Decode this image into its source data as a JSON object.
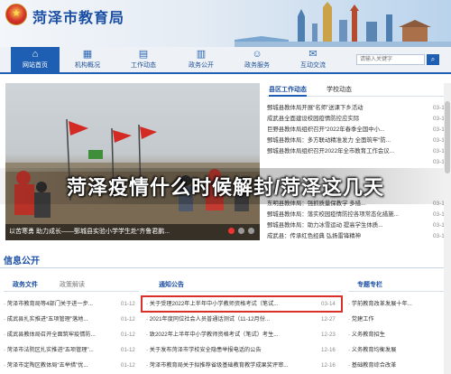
{
  "header": {
    "site_title": "菏泽市教育局",
    "search_placeholder": "请输入关键字"
  },
  "nav": [
    {
      "label": "网站首页",
      "icon": "home-icon",
      "active": true
    },
    {
      "label": "机构概况",
      "icon": "building-icon",
      "active": false
    },
    {
      "label": "工作动态",
      "icon": "document-icon",
      "active": false
    },
    {
      "label": "政务公开",
      "icon": "book-icon",
      "active": false
    },
    {
      "label": "政务服务",
      "icon": "people-icon",
      "active": false
    },
    {
      "label": "互动交流",
      "icon": "chat-icon",
      "active": false
    }
  ],
  "photo": {
    "caption": "以苦寒勇 助力成长——鄄城县实验小学学生赴“齐鲁君鹏..."
  },
  "news_tabs": [
    "县区工作动态",
    "学校动态"
  ],
  "news": [
    {
      "title": "鄄城县教体局开展“名师”送课下乡活动",
      "date": "03-1"
    },
    {
      "title": "成武县全面建设校园疫情防控应实际",
      "date": "03-1"
    },
    {
      "title": "巨野县教体局组织召开“2022年春季全国中小...",
      "date": "03-1"
    },
    {
      "title": "鄄城县教体局：多方联动精准发力 全面筑牢“防...",
      "date": "03-1"
    },
    {
      "title": "鄄城县教体局组织召开2022年全市教育工作会议...",
      "date": "03-1"
    },
    {
      "title": "",
      "date": "03-1"
    },
    {
      "title": "东明县教体局：强抓质量保教学 多措...",
      "date": "03-1"
    },
    {
      "title": "鄄城县教体局：落实校园疫情防控各项常态化措施...",
      "date": "03-1"
    },
    {
      "title": "鄄城县教体局：助力冰雪运动 提高学生体质...",
      "date": "03-1"
    },
    {
      "title": "成武县：传承红色经典 弘扬雷锋精神",
      "date": "03-1"
    }
  ],
  "overlay_title": "菏泽疫情什么时候解封/菏泽这几天",
  "info": {
    "heading": "信息公开",
    "col1_tabs": [
      "政务文件",
      "政策解读"
    ],
    "col2_tab": "通知公告",
    "col3_tab": "专题专栏",
    "col1": [
      {
        "title": "菏泽市教育局等4部门关于进一步...",
        "date": "01-12"
      },
      {
        "title": "成武县扎实推进“五项管理”落地...",
        "date": "01-12"
      },
      {
        "title": "成武县教体局召开全面筑牢疫情防...",
        "date": "01-12"
      },
      {
        "title": "菏泽市法院区扎实推进“五项管理”...",
        "date": "01-12"
      },
      {
        "title": "菏泽市定陶区教体局“五举措”优...",
        "date": "01-12"
      }
    ],
    "col2": [
      {
        "title": "关于受理2022年上半年中小学教师资格考试（笔试...",
        "date": "03-14"
      },
      {
        "title": "2021年度同位社会人员普通话测试（11-12月份...",
        "date": "12-27"
      },
      {
        "title": "致2022年上半年中小学教师资格考试（笔试）考生...",
        "date": "12-23"
      },
      {
        "title": "关于发布菏泽市学校安全隐患举报电话的公告",
        "date": "12-16"
      },
      {
        "title": "菏泽市教育局关于拟推荐省级基础教育教学成果奖评审...",
        "date": "12-16"
      }
    ],
    "col3": [
      {
        "title": "学前教育改革发展十年...",
        "date": ""
      },
      {
        "title": "党建工作",
        "date": ""
      },
      {
        "title": "义务教育招生",
        "date": ""
      },
      {
        "title": "义务教育均衡发展",
        "date": ""
      },
      {
        "title": "基础教育综合改革",
        "date": ""
      }
    ]
  },
  "colors": {
    "brand": "#1f5fb3",
    "highlight": "#d9302a"
  }
}
